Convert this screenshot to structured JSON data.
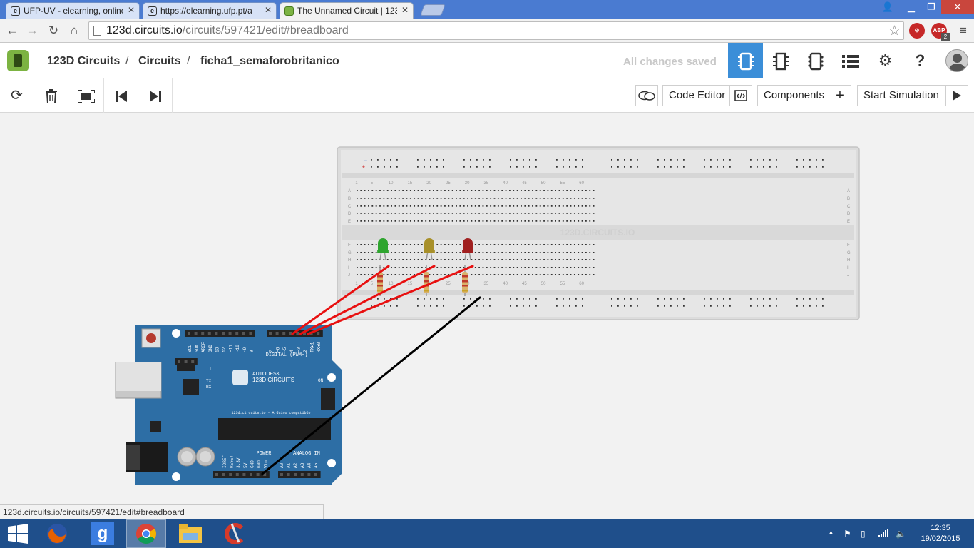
{
  "browser": {
    "tabs": [
      {
        "label": "UFP-UV - elearning, online",
        "favicon": "e"
      },
      {
        "label": "https://elearning.ufp.pt/a",
        "favicon": "e"
      },
      {
        "label": "The Unnamed Circuit | 123",
        "favicon": ""
      }
    ],
    "url_host": "123d.circuits.io",
    "url_path": "/circuits/597421/edit#breadboard",
    "extensions": [
      "ABP"
    ],
    "extension_badge": "2"
  },
  "app": {
    "breadcrumb": [
      "123D Circuits",
      "Circuits",
      "ficha1_semaforobritanico"
    ],
    "breadcrumb_separator": "/",
    "save_status": "All changes saved",
    "views": [
      "breadboard-view",
      "schematic-view",
      "pcb-view",
      "component-list",
      "settings",
      "help"
    ],
    "help_label": "?"
  },
  "toolbar": {
    "code_editor_label": "Code Editor",
    "components_label": "Components",
    "components_add": "+",
    "start_simulation_label": "Start Simulation"
  },
  "breadboard": {
    "watermark": "123D.CIRCUITS.IO",
    "column_numbers": [
      "1",
      "5",
      "10",
      "15",
      "20",
      "25",
      "30",
      "35",
      "40",
      "45",
      "50",
      "55",
      "60"
    ],
    "row_letters_top": [
      "A",
      "B",
      "C",
      "D",
      "E"
    ],
    "row_letters_bottom": [
      "F",
      "G",
      "H",
      "I",
      "J"
    ],
    "rail_minus": "−",
    "rail_plus": "+"
  },
  "components": {
    "leds": [
      {
        "color": "green",
        "hex": "#2fa52f"
      },
      {
        "color": "yellow",
        "hex": "#a8902a"
      },
      {
        "color": "red",
        "hex": "#a02020"
      }
    ],
    "wire_colors": {
      "signal": "#e81010",
      "ground": "#000000"
    }
  },
  "arduino": {
    "logo_line1": "AUTODESK",
    "logo_line2": "123D CIRCUITS",
    "subtitle": "123d.circuits.io - Arduino compatible",
    "digital_label": "DIGITAL (PWM~)",
    "power_label": "POWER",
    "analog_label": "ANALOG IN",
    "on_label": "ON",
    "tx_label": "TX",
    "rx_label": "RX",
    "l_label": "L",
    "top_pins": [
      "SCL",
      "SDA",
      "AREF",
      "GND",
      "13",
      "12",
      "~11",
      "~10",
      "~9",
      "8",
      "7",
      "~6",
      "~5",
      "4",
      "~3",
      "2",
      "TX►1",
      "RX◄0"
    ],
    "power_pins": [
      "IOREF",
      "RESET",
      "3.3V",
      "5V",
      "GND",
      "GND",
      "Vin"
    ],
    "analog_pins": [
      "A0",
      "A1",
      "A2",
      "A3",
      "A4",
      "A5"
    ]
  },
  "status_url": "123d.circuits.io/circuits/597421/edit#breadboard",
  "taskbar": {
    "apps": [
      "start",
      "firefox",
      "google",
      "chrome",
      "file-explorer",
      "ccleaner"
    ],
    "time": "12:35",
    "date": "19/02/2015"
  }
}
